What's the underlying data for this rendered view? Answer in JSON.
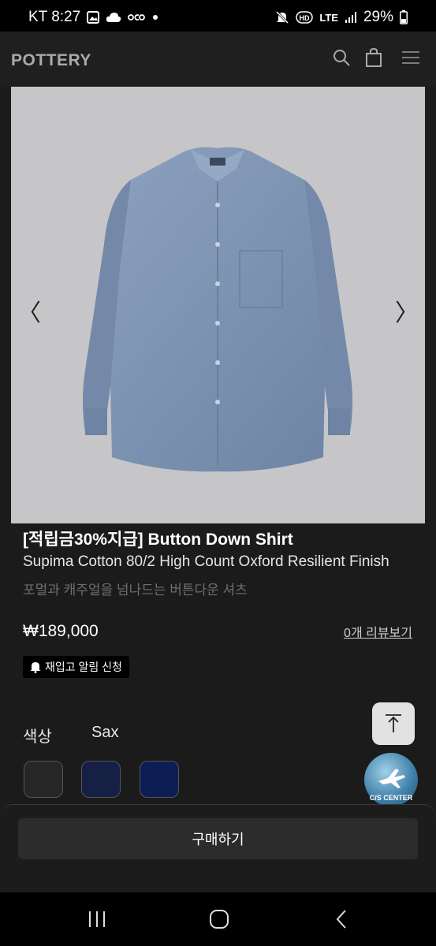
{
  "status_bar": {
    "carrier_time": "KT 8:27",
    "network": "LTE",
    "battery": "29%"
  },
  "header": {
    "logo": "POTTERY"
  },
  "product": {
    "title": "[적립금30%지급] Button Down Shirt",
    "subtitle": "Supima Cotton 80/2 High Count Oxford Resilient Finish",
    "description": "포멀과 캐주얼을 넘나드는 버튼다운 셔츠",
    "price": "₩189,000",
    "review_link": "0개 리뷰보기",
    "restock_label": "재입고 알림 신청"
  },
  "gallery": {
    "prev": "〈",
    "next": "〉"
  },
  "options": {
    "color_label": "색상",
    "color_value": "Sax",
    "swatches": [
      "#262626",
      "#152044",
      "#0d1e55"
    ]
  },
  "cs_center": "C/S CENTER",
  "buy_label": "구매하기"
}
